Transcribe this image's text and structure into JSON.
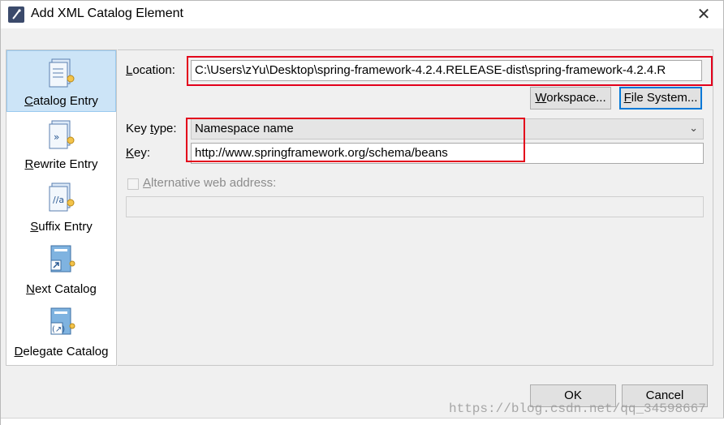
{
  "window": {
    "title": "Add XML Catalog Element",
    "close_icon": "close-icon"
  },
  "categories": [
    {
      "label": "Catalog Entry",
      "mnemonic": "C",
      "rest": "atalog Entry",
      "selected": true,
      "icon": "catalog-entry-icon"
    },
    {
      "label": "Rewrite Entry",
      "mnemonic": "R",
      "rest": "ewrite Entry",
      "selected": false,
      "icon": "rewrite-entry-icon"
    },
    {
      "label": "Suffix Entry",
      "mnemonic": "S",
      "rest": "uffix Entry",
      "selected": false,
      "icon": "suffix-entry-icon"
    },
    {
      "label": "Next Catalog",
      "mnemonic": "N",
      "rest": "ext Catalog",
      "selected": false,
      "icon": "next-catalog-icon"
    },
    {
      "label": "Delegate Catalog",
      "mnemonic": "D",
      "rest": "elegate Catalog",
      "selected": false,
      "icon": "delegate-catalog-icon"
    }
  ],
  "form": {
    "location_label_mn": "L",
    "location_label_rest": "ocation:",
    "location_value": "C:\\Users\\zYu\\Desktop\\spring-framework-4.2.4.RELEASE-dist\\spring-framework-4.2.4.R",
    "workspace_mn": "W",
    "workspace_rest": "orkspace...",
    "filesystem_mn": "F",
    "filesystem_rest": "ile System...",
    "key_type_label_pre": "Key ",
    "key_type_label_mn": "t",
    "key_type_label_rest": "ype:",
    "key_type_value": "Namespace name",
    "key_label_mn": "K",
    "key_label_rest": "ey:",
    "key_value": "http://www.springframework.org/schema/beans",
    "alt_mn": "A",
    "alt_rest": "lternative web address:",
    "alt_checked": false
  },
  "footer": {
    "ok": "OK",
    "cancel": "Cancel"
  },
  "watermark": "https://blog.csdn.net/qq_34598667",
  "colors": {
    "highlight_red": "#e3001b",
    "selection_blue": "#cce4f7",
    "focus_blue": "#0078d7"
  }
}
